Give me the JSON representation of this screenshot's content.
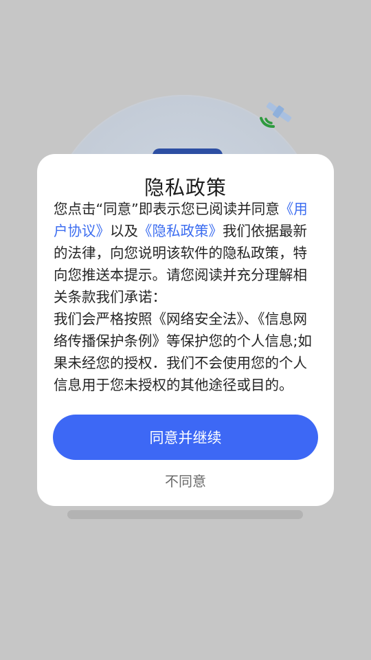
{
  "dialog": {
    "title": "隐私政策",
    "intro_1": "您点击“同意”即表示您已阅读并同意",
    "link_user_agreement": "《用户协议》",
    "and_text": "以及",
    "link_privacy_policy": "《隐私政策》",
    "intro_2": "我们依据最新的法律，向您说明该软件的隐私政策，特向您推送本提示。请您阅读并充分理解相关条款我们承诺：",
    "paragraph_2": "我们会严格按照《网络安全法》、《信息网络传播保护条例》等保护您的个人信息;如果未经您的授权．我们不会使用您的个人信息用于您未授权的其他途径或目的。",
    "agree_button": "同意并继续",
    "disagree_button": "不同意"
  },
  "colors": {
    "accent": "#3d68f5",
    "link": "#3c6df0",
    "overlay": "#c6c6c6"
  },
  "icons": {
    "satellite": "satellite-icon"
  }
}
